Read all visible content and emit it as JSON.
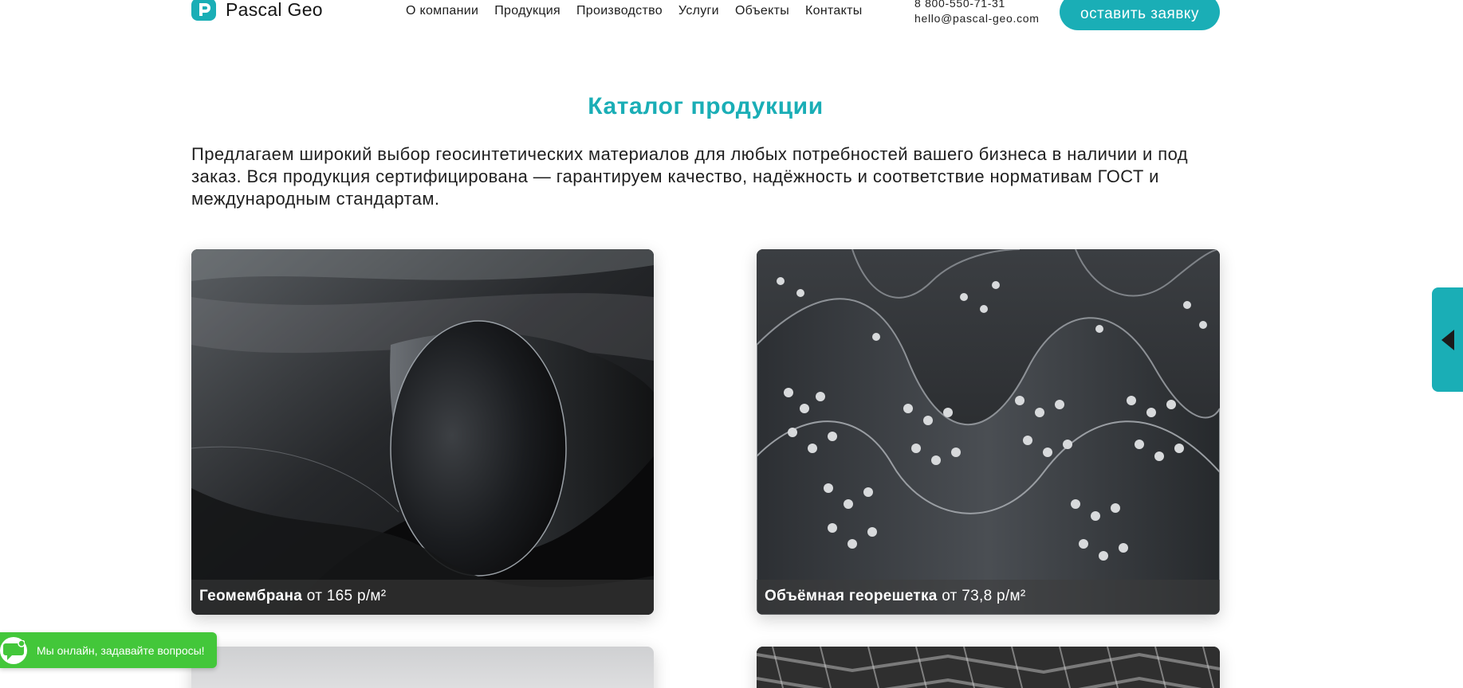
{
  "colors": {
    "accent": "#1aaeb6",
    "chat_green": "#43c73a"
  },
  "header": {
    "logo_text": "Pascal Geo",
    "logo_icon": "pascal-p-logo-icon",
    "nav": [
      {
        "label": "О компании"
      },
      {
        "label": "Продукция"
      },
      {
        "label": "Производство"
      },
      {
        "label": "Услуги"
      },
      {
        "label": "Объекты"
      },
      {
        "label": "Контакты"
      }
    ],
    "phone": "8 800-550-71-31",
    "email": "hello@pascal-geo.com",
    "cta_label": "оставить заявку"
  },
  "catalog": {
    "title": "Каталог продукции",
    "intro": "Предлагаем широкий выбор геосинтетических материалов для любых потребностей вашего бизнеса в наличии и под заказ. Вся продукция сертифицирована — гарантируем качество, надёжность и соответствие нормативам ГОСТ и международным стандартам.",
    "products": [
      {
        "name": "Геомембрана",
        "price": "от 165 р/м²"
      },
      {
        "name": "Объёмная георешетка",
        "price": "от 73,8 р/м²"
      }
    ]
  },
  "side_tab": {
    "icon": "triangle-left-icon"
  },
  "chat": {
    "text": "Мы онлайн, задавайте вопросы!",
    "icon": "chat-bubble-icon"
  }
}
